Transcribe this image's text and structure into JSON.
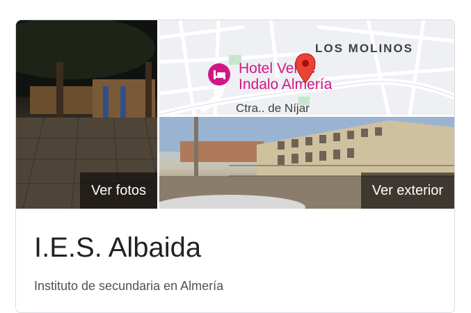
{
  "gallery": {
    "photos_button": "Ver fotos",
    "exterior_button": "Ver exterior"
  },
  "map": {
    "area_label": "LOS MOLINOS",
    "poi_name_line1": "Hotel Velice",
    "poi_name_line2": "Indalo Almería",
    "road_label": "Ctra.. de Níjar",
    "poi_color": "#d01884",
    "marker_color": "#ea4335"
  },
  "place": {
    "name": "I.E.S. Albaida",
    "category": "Instituto de secundaria en Almería"
  }
}
